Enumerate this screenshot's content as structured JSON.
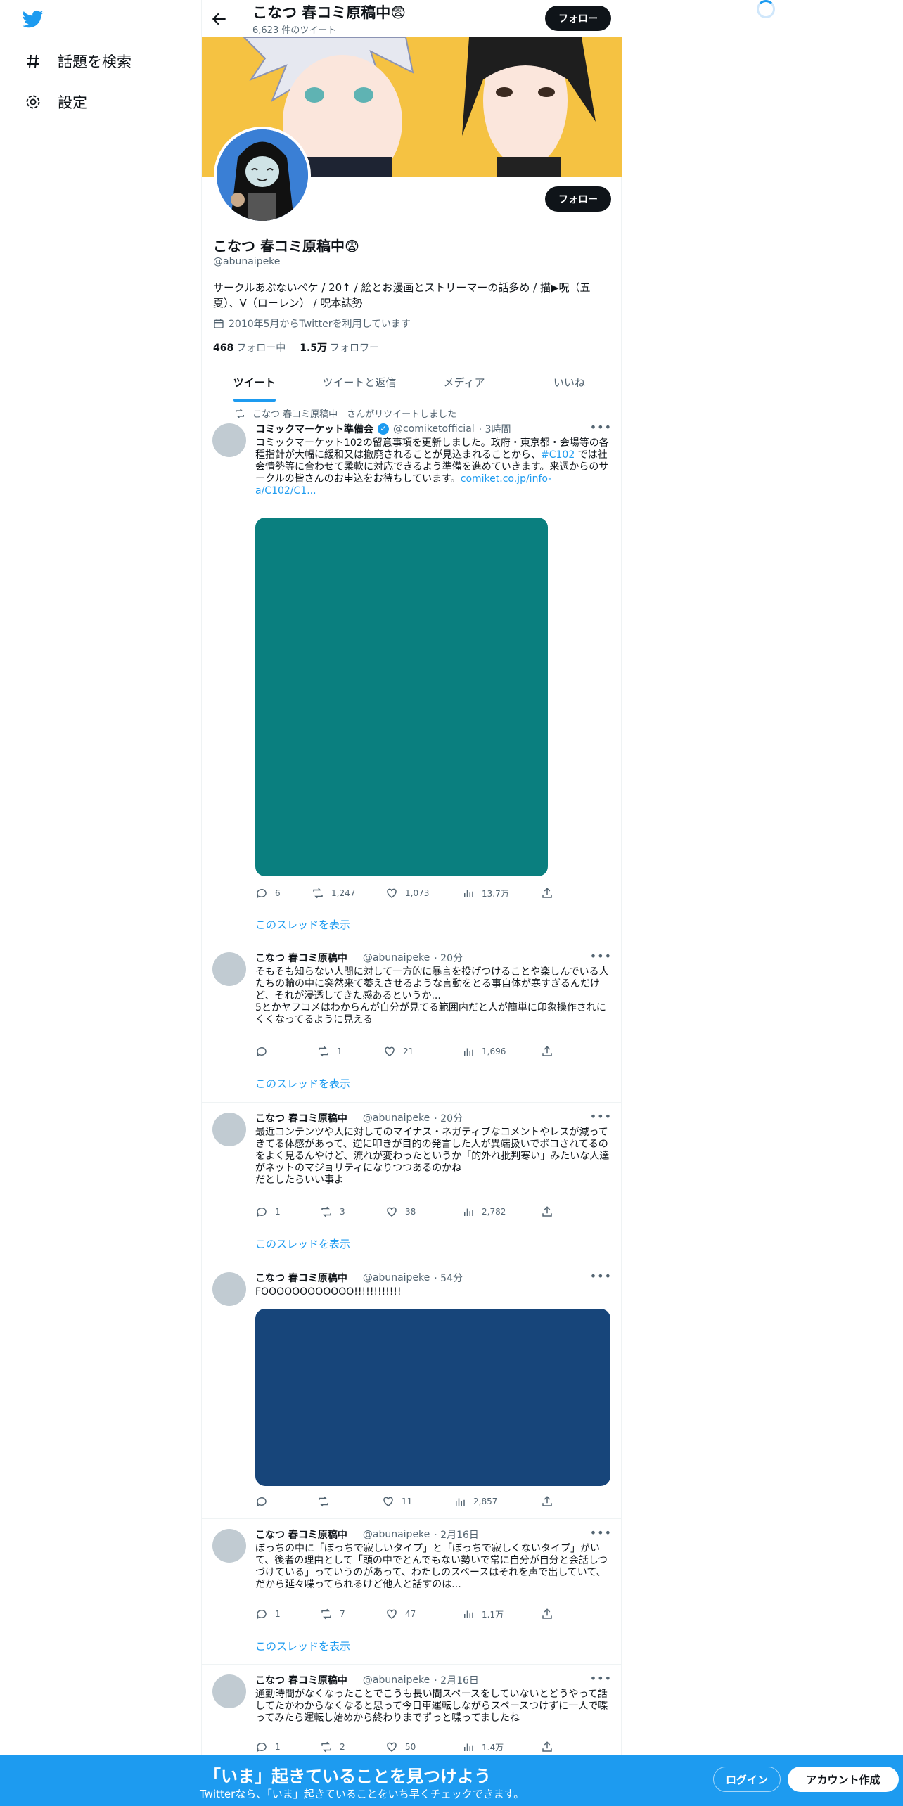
{
  "nav": {
    "explore_label": "話題を検索",
    "settings_label": "設定"
  },
  "header": {
    "name": "こなつ 春コミ原稿中😨",
    "tweet_count": "6,623 件のツイート",
    "follow_label": "フォロー"
  },
  "profile": {
    "name": "こなつ 春コミ原稿中😨",
    "handle": "@abunaipeke",
    "bio": "サークルあぶないペケ / 20↑ / 絵とお漫画とストリーマーの話多め / 描▶呪（五夏）、V（ローレン） / 呪本誌勢",
    "joined": "2010年5月からTwitterを利用しています",
    "following_count": "468",
    "following_label": "フォロー中",
    "followers_count": "1.5万",
    "followers_label": "フォロワー",
    "follow_label": "フォロー"
  },
  "tabs": [
    "ツイート",
    "ツイートと返信",
    "メディア",
    "いいね"
  ],
  "tweets": [
    {
      "retweet_note": "こなつ 春コミ原稿中　さんがリツイートしました",
      "name": "コミックマーケット準備会",
      "handle": "@comiketofficial",
      "time": "· 3時間",
      "text1": "コミックマーケット102の留意事項を更新しました。政府・東京都・会場等の各種指針が大幅に緩和又は撤廃されることが見込まれることから、",
      "hashtag": "#C102",
      "text2": " では社会情勢等に合わせて柔軟に対応できるよう準備を進めていきます。来週からのサークルの皆さんのお申込をお待ちしています。",
      "link": "comiket.co.jp/info-a/C102/C1...",
      "media_color": "#0a7f7f",
      "replies": "6",
      "retweets": "1,247",
      "likes": "1,073",
      "views": "13.7万",
      "thread": "このスレッドを表示"
    },
    {
      "name": "こなつ 春コミ原稿中",
      "handle": "@abunaipeke",
      "time": "· 20分",
      "text": "そもそも知らない人間に対して一方的に暴言を投げつけることや楽しんでいる人たちの輪の中に突然来て萎えさせるような言動をとる事自体が寒すぎるんだけど、それが浸透してきた感あるというか...\n5とかヤフコメはわからんが自分が見てる範囲内だと人が簡単に印象操作されにくくなってるように見える",
      "replies": "",
      "retweets": "1",
      "likes": "21",
      "views": "1,696",
      "thread": "このスレッドを表示"
    },
    {
      "name": "こなつ 春コミ原稿中",
      "handle": "@abunaipeke",
      "time": "· 20分",
      "text": "最近コンテンツや人に対してのマイナス・ネガティブなコメントやレスが減ってきてる体感があって、逆に叩きが目的の発言した人が異端扱いでボコされてるのをよく見るんやけど、流れが変わったというか「的外れ批判寒い」みたいな人達がネットのマジョリティになりつつあるのかね\nだとしたらいい事よ",
      "replies": "1",
      "retweets": "3",
      "likes": "38",
      "views": "2,782",
      "thread": "このスレッドを表示"
    },
    {
      "name": "こなつ 春コミ原稿中",
      "handle": "@abunaipeke",
      "time": "· 54分",
      "text": "FOOOOOOOOOOOO!!!!!!!!!!!!",
      "media_color": "#17457a",
      "replies": "",
      "retweets": "",
      "likes": "11",
      "views": "2,857"
    },
    {
      "name": "こなつ 春コミ原稿中",
      "handle": "@abunaipeke",
      "time": "· 2月16日",
      "text": "ぼっちの中に「ぼっちで寂しいタイプ」と「ぼっちで寂しくないタイプ」がいて、後者の理由として「頭の中でとんでもない勢いで常に自分が自分と会話しつづけている」っていうのがあって、わたしのスペースはそれを声で出していて、だから延々喋ってられるけど他人と話すのは...",
      "replies": "1",
      "retweets": "7",
      "likes": "47",
      "views": "1.1万",
      "thread": "このスレッドを表示"
    },
    {
      "name": "こなつ 春コミ原稿中",
      "handle": "@abunaipeke",
      "time": "· 2月16日",
      "text": "通勤時間がなくなったことでこうも長い間スペースをしていないとどうやって話してたかわからなくなると思って今日車運転しながらスペースつけずに一人で喋ってみたら運転し始めから終わりまでずっと喋ってましたね",
      "replies": "1",
      "retweets": "2",
      "likes": "50",
      "views": "1.4万"
    }
  ],
  "bottom_bar": {
    "title": "「いま」起きていることを見つけよう",
    "subtitle": "Twitterなら、「いま」起きていることをいち早くチェックできます。",
    "login_label": "ログイン",
    "signup_label": "アカウント作成"
  },
  "colors": {
    "accent": "#1d9bf0",
    "banner": "#f5c242"
  }
}
